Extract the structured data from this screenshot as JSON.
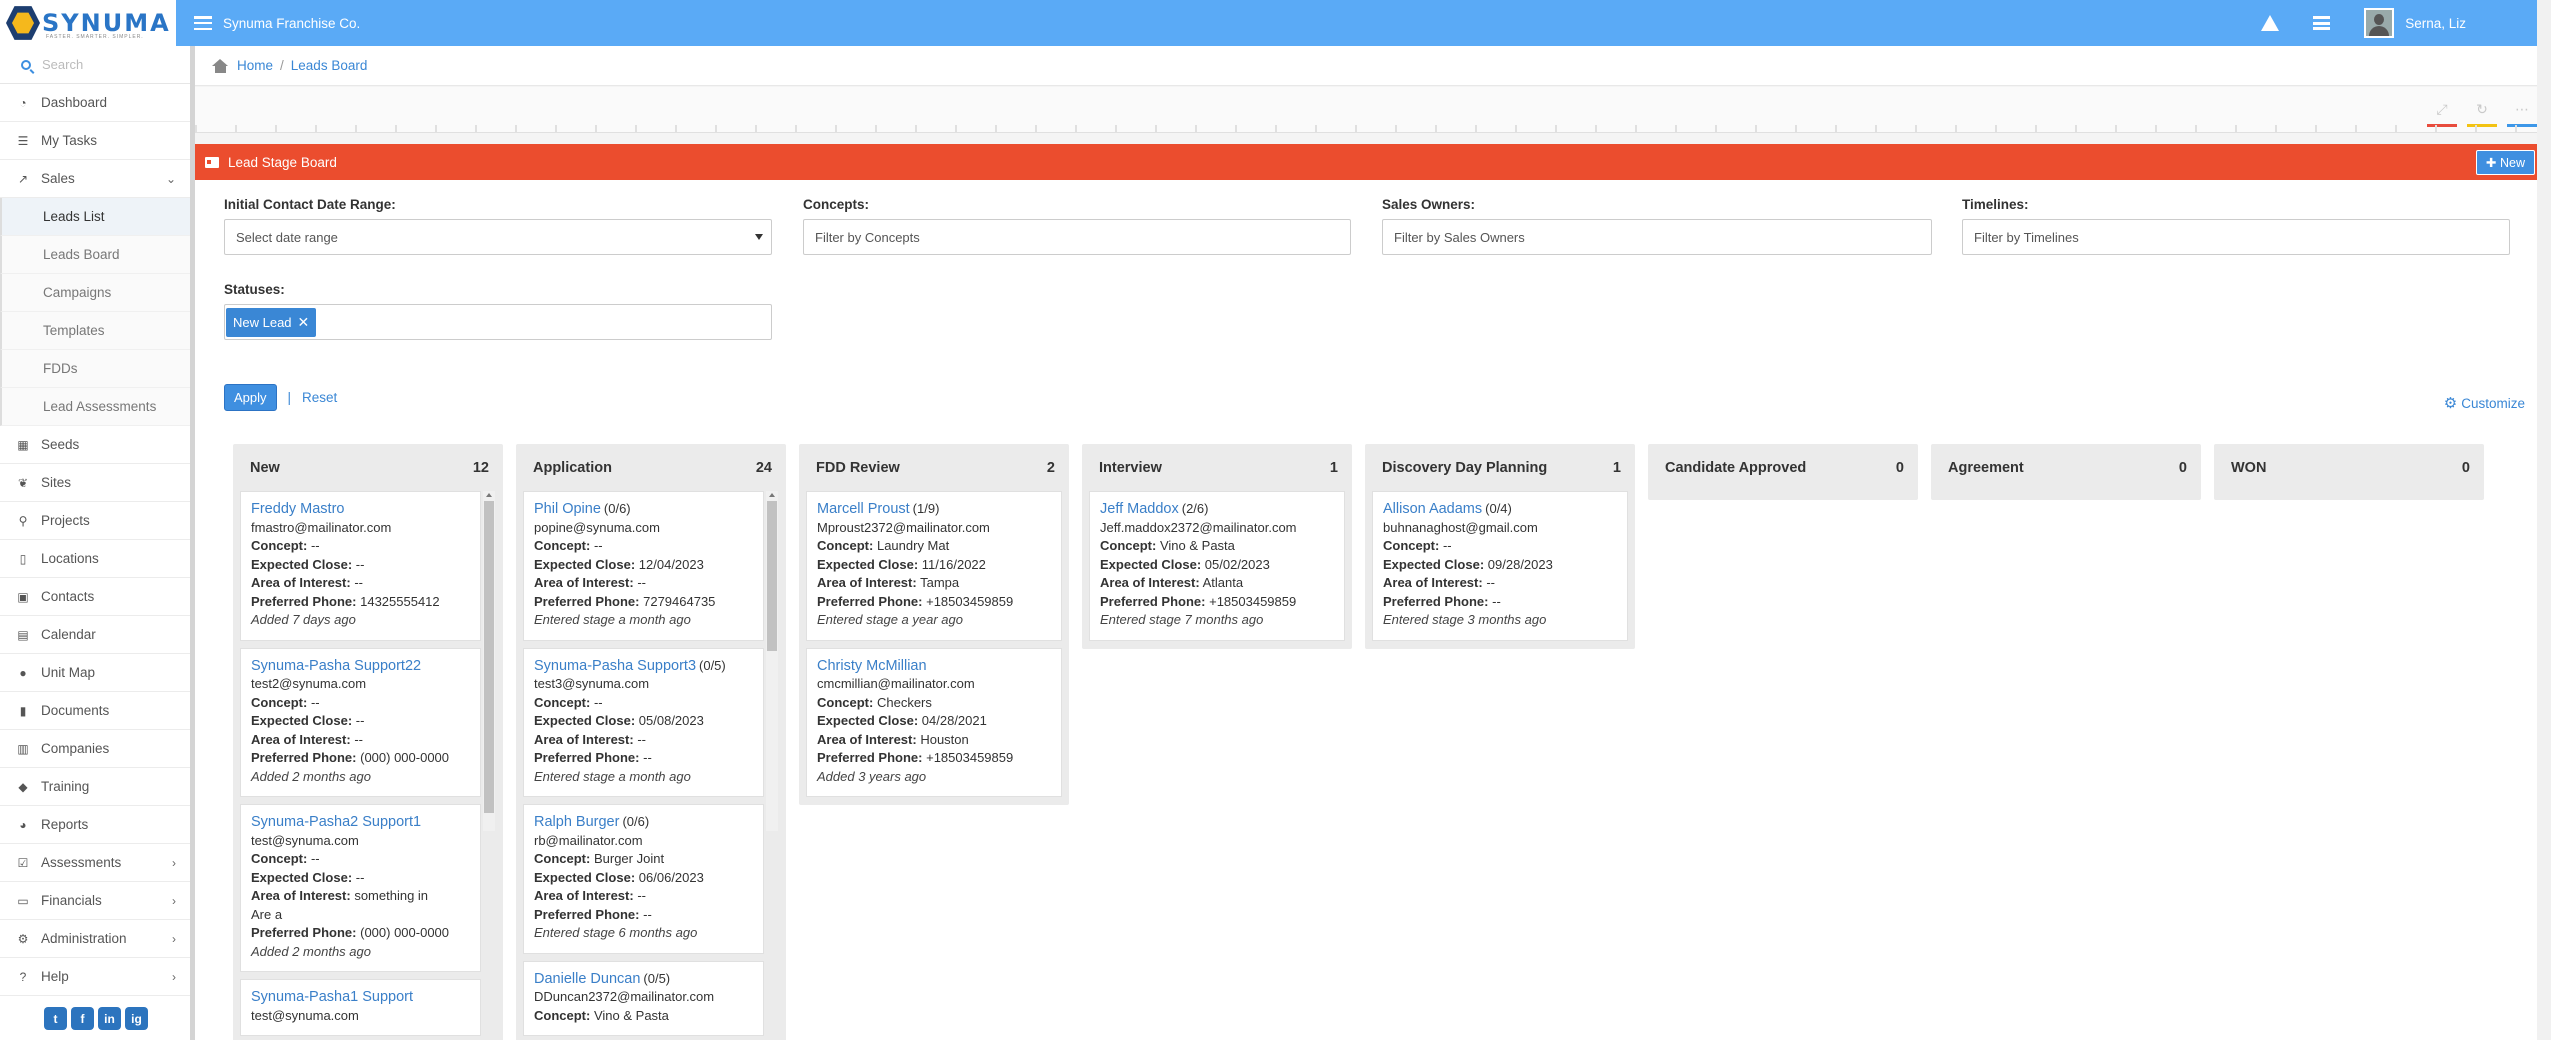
{
  "app": {
    "logo_text": "SYNUMA",
    "logo_tag": "FASTER. SMARTER. SIMPLER.",
    "company": "Synuma Franchise Co.",
    "user": "Serna, Liz"
  },
  "sidebar": {
    "search_placeholder": "Search",
    "items": [
      {
        "label": "Dashboard",
        "icon": "dashboard-icon"
      },
      {
        "label": "My Tasks",
        "icon": "tasks-icon"
      },
      {
        "label": "Sales",
        "icon": "chart-icon"
      },
      {
        "label": "Seeds",
        "icon": "grid-icon"
      },
      {
        "label": "Sites",
        "icon": "leaf-icon"
      },
      {
        "label": "Projects",
        "icon": "sitemap-icon"
      },
      {
        "label": "Locations",
        "icon": "building-icon"
      },
      {
        "label": "Contacts",
        "icon": "contacts-icon"
      },
      {
        "label": "Calendar",
        "icon": "calendar-icon"
      },
      {
        "label": "Unit Map",
        "icon": "globe-icon"
      },
      {
        "label": "Documents",
        "icon": "document-icon"
      },
      {
        "label": "Companies",
        "icon": "company-icon"
      },
      {
        "label": "Training",
        "icon": "graduation-icon"
      },
      {
        "label": "Reports",
        "icon": "pie-icon"
      },
      {
        "label": "Assessments",
        "icon": "check-icon"
      },
      {
        "label": "Financials",
        "icon": "money-icon"
      },
      {
        "label": "Administration",
        "icon": "gears-icon"
      },
      {
        "label": "Help",
        "icon": "help-icon"
      }
    ],
    "sales_sub": [
      "Leads List",
      "Leads Board",
      "Campaigns",
      "Templates",
      "FDDs",
      "Lead Assessments"
    ],
    "social": [
      "t",
      "f",
      "in",
      "ig"
    ]
  },
  "breadcrumb": {
    "home": "Home",
    "current": "Leads Board"
  },
  "panel": {
    "title": "Lead Stage Board",
    "new_button": "New"
  },
  "filters": {
    "date_range_label": "Initial Contact Date Range:",
    "date_range_value": "Select date range",
    "concepts_label": "Concepts:",
    "concepts_placeholder": "Filter by Concepts",
    "owners_label": "Sales Owners:",
    "owners_placeholder": "Filter by Sales Owners",
    "timelines_label": "Timelines:",
    "timelines_placeholder": "Filter by Timelines",
    "statuses_label": "Statuses:",
    "status_tag": "New Lead",
    "apply": "Apply",
    "pipe": "|",
    "reset": "Reset",
    "customize": "Customize"
  },
  "labels": {
    "concept": "Concept:",
    "expected_close": "Expected Close:",
    "area": "Area of Interest:",
    "phone": "Preferred Phone:"
  },
  "columns": [
    {
      "title": "New",
      "count": "12",
      "leads": [
        {
          "name": "Freddy Mastro",
          "score": "",
          "email": "fmastro@mailinator.com",
          "concept": "--",
          "close": "--",
          "area": "--",
          "phone": "14325555412",
          "foot": "Added 7 days ago"
        },
        {
          "name": "Synuma-Pasha Support22",
          "score": "",
          "email": "test2@synuma.com",
          "concept": "--",
          "close": "--",
          "area": "--",
          "phone": "(000) 000-0000",
          "foot": "Added 2 months ago"
        },
        {
          "name": "Synuma-Pasha2 Support1",
          "score": "",
          "email": "test@synuma.com",
          "concept": "--",
          "close": "--",
          "area": "something in Are a",
          "phone": "(000) 000-0000",
          "foot": "Added 2 months ago"
        },
        {
          "name": "Synuma-Pasha1 Support",
          "score": "",
          "email": "test@synuma.com",
          "concept": "",
          "close": "",
          "area": "",
          "phone": "",
          "foot": ""
        }
      ]
    },
    {
      "title": "Application",
      "count": "24",
      "leads": [
        {
          "name": "Phil Opine",
          "score": "(0/6)",
          "email": "popine@synuma.com",
          "concept": "--",
          "close": "12/04/2023",
          "area": "--",
          "phone": "7279464735",
          "foot": "Entered stage a month ago"
        },
        {
          "name": "Synuma-Pasha Support3",
          "score": "(0/5)",
          "email": "test3@synuma.com",
          "concept": "--",
          "close": "05/08/2023",
          "area": "--",
          "phone": "--",
          "foot": "Entered stage a month ago"
        },
        {
          "name": "Ralph Burger",
          "score": "(0/6)",
          "email": "rb@mailinator.com",
          "concept": "Burger Joint",
          "close": "06/06/2023",
          "area": "--",
          "phone": "--",
          "foot": "Entered stage 6 months ago"
        },
        {
          "name": "Danielle Duncan",
          "score": "(0/5)",
          "email": "DDuncan2372@mailinator.com",
          "concept": "Vino & Pasta",
          "close": "",
          "area": "",
          "phone": "",
          "foot": ""
        }
      ]
    },
    {
      "title": "FDD Review",
      "count": "2",
      "leads": [
        {
          "name": "Marcell Proust",
          "score": "(1/9)",
          "email": "Mproust2372@mailinator.com",
          "concept": "Laundry Mat",
          "close": "11/16/2022",
          "area": "Tampa",
          "phone": "+18503459859",
          "foot": "Entered stage a year ago"
        },
        {
          "name": "Christy McMillian",
          "score": "",
          "email": "cmcmillian@mailinator.com",
          "concept": "Checkers",
          "close": "04/28/2021",
          "area": "Houston",
          "phone": "+18503459859",
          "foot": "Added 3 years ago"
        }
      ]
    },
    {
      "title": "Interview",
      "count": "1",
      "leads": [
        {
          "name": "Jeff Maddox",
          "score": "(2/6)",
          "email": "Jeff.maddox2372@mailinator.com",
          "concept": "Vino & Pasta",
          "close": "05/02/2023",
          "area": "Atlanta",
          "phone": "+18503459859",
          "foot": "Entered stage 7 months ago"
        }
      ]
    },
    {
      "title": "Discovery Day Planning",
      "count": "1",
      "leads": [
        {
          "name": "Allison Aadams",
          "score": "(0/4)",
          "email": "buhnanaghost@gmail.com",
          "concept": "--",
          "close": "09/28/2023",
          "area": "--",
          "phone": "--",
          "foot": "Entered stage 3 months ago"
        }
      ]
    },
    {
      "title": "Candidate Approved",
      "count": "0",
      "leads": []
    },
    {
      "title": "Agreement",
      "count": "0",
      "leads": []
    },
    {
      "title": "WON",
      "count": "0",
      "leads": []
    }
  ],
  "colors": {
    "topbar": "#5aaaf6",
    "panel_header": "#eb4d2e",
    "link": "#3a87d5"
  }
}
